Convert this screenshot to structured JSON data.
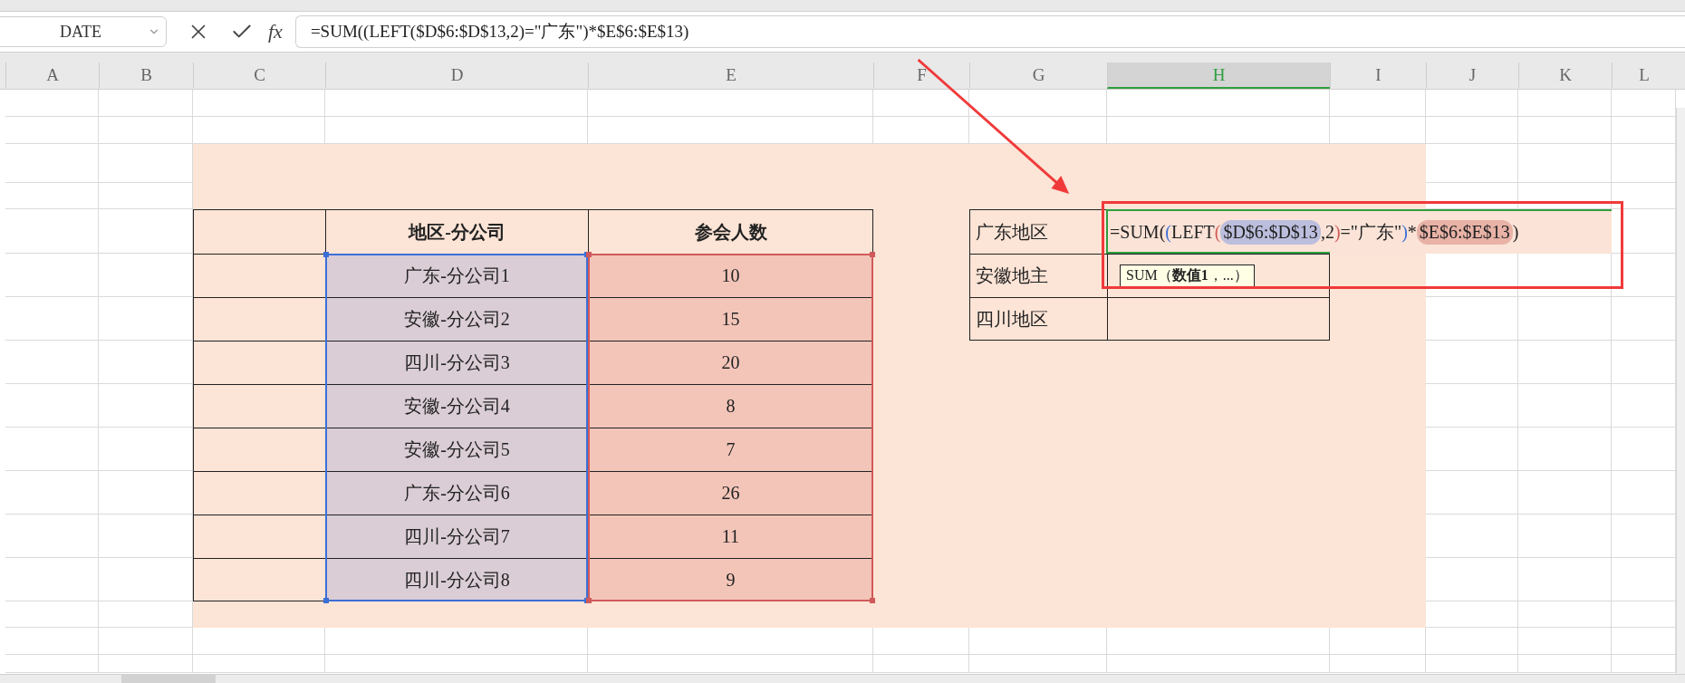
{
  "name_box": "DATE",
  "formula_bar": {
    "fx_label": "fx",
    "formula": "=SUM((LEFT($D$6:$D$13,2)=\"广东\")*$E$6:$E$13)"
  },
  "column_headers": [
    {
      "label": "A",
      "selected": false
    },
    {
      "label": "B",
      "selected": false
    },
    {
      "label": "C",
      "selected": false
    },
    {
      "label": "D",
      "selected": false
    },
    {
      "label": "E",
      "selected": false
    },
    {
      "label": "F",
      "selected": false
    },
    {
      "label": "G",
      "selected": false
    },
    {
      "label": "H",
      "selected": true
    },
    {
      "label": "I",
      "selected": false
    },
    {
      "label": "J",
      "selected": false
    },
    {
      "label": "K",
      "selected": false
    },
    {
      "label": "L",
      "selected": false
    }
  ],
  "left_table": {
    "columns": [
      "地区-分公司",
      "参会人数"
    ],
    "rows": [
      {
        "branch": "广东-分公司1",
        "attendees": "10"
      },
      {
        "branch": "安徽-分公司2",
        "attendees": "15"
      },
      {
        "branch": "四川-分公司3",
        "attendees": "20"
      },
      {
        "branch": "安徽-分公司4",
        "attendees": "8"
      },
      {
        "branch": "安徽-分公司5",
        "attendees": "7"
      },
      {
        "branch": "广东-分公司6",
        "attendees": "26"
      },
      {
        "branch": "四川-分公司7",
        "attendees": "11"
      },
      {
        "branch": "四川-分公司8",
        "attendees": "9"
      }
    ]
  },
  "right_table": {
    "labels": [
      "广东地区",
      "安徽地主",
      "四川地区"
    ]
  },
  "cell_editor": {
    "segments": [
      {
        "kind": "text",
        "text": "=SUM("
      },
      {
        "kind": "paren",
        "text": "(",
        "color": "#3b6fd6"
      },
      {
        "kind": "text",
        "text": "LEFT"
      },
      {
        "kind": "paren",
        "text": "(",
        "color": "#d05a5a"
      },
      {
        "kind": "range",
        "text": "$D$6:$D$13",
        "color": "#bcbedd"
      },
      {
        "kind": "text",
        "text": ",2"
      },
      {
        "kind": "paren",
        "text": ")",
        "color": "#d05a5a"
      },
      {
        "kind": "text",
        "text": "=\"广东\""
      },
      {
        "kind": "paren",
        "text": ")",
        "color": "#3b6fd6"
      },
      {
        "kind": "text",
        "text": "*"
      },
      {
        "kind": "range",
        "text": "$E$6:$E$13",
        "color": "#e8b2a6"
      },
      {
        "kind": "text",
        "text": ")"
      }
    ]
  },
  "function_tooltip": "SUM（**数值1**，...）"
}
